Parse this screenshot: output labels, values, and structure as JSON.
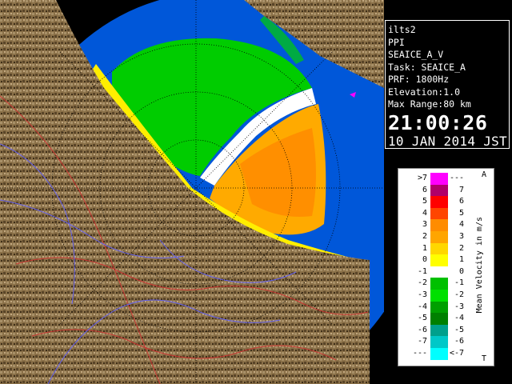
{
  "info": {
    "site": "ilts2",
    "mode": "PPI",
    "product": "SEAICE_A_V",
    "task": "Task: SEAICE_A",
    "prf": "PRF: 1800Hz",
    "elevation": "Elevation:1.0",
    "max_range": "Max Range:80 km",
    "time": "21:00:26",
    "date": "10 JAN 2014 JST"
  },
  "legend": {
    "unit_label": "Mean Velocity in m/s",
    "top_mark": "A",
    "bottom_mark": "T",
    "rows": [
      {
        "left": ">7",
        "right": "---",
        "color": "#ff00ff"
      },
      {
        "left": "6",
        "right": "7",
        "color": "#b0006a"
      },
      {
        "left": "5",
        "right": "6",
        "color": "#ff0000"
      },
      {
        "left": "4",
        "right": "5",
        "color": "#ff4500"
      },
      {
        "left": "3",
        "right": "4",
        "color": "#ff8c00"
      },
      {
        "left": "2",
        "right": "3",
        "color": "#ffa500"
      },
      {
        "left": "1",
        "right": "2",
        "color": "#ffd700"
      },
      {
        "left": "0",
        "right": "1",
        "color": "#ffff00"
      },
      {
        "left": "-1",
        "right": "0",
        "color": "#ffffff"
      },
      {
        "left": "-2",
        "right": "-1",
        "color": "#00c000"
      },
      {
        "left": "-3",
        "right": "-2",
        "color": "#00e000"
      },
      {
        "left": "-4",
        "right": "-3",
        "color": "#00a000"
      },
      {
        "left": "-5",
        "right": "-4",
        "color": "#008000"
      },
      {
        "left": "-6",
        "right": "-5",
        "color": "#00a08c"
      },
      {
        "left": "-7",
        "right": "-6",
        "color": "#00c8c8"
      },
      {
        "left": "---",
        "right": "<-7",
        "color": "#00ffff"
      }
    ]
  }
}
